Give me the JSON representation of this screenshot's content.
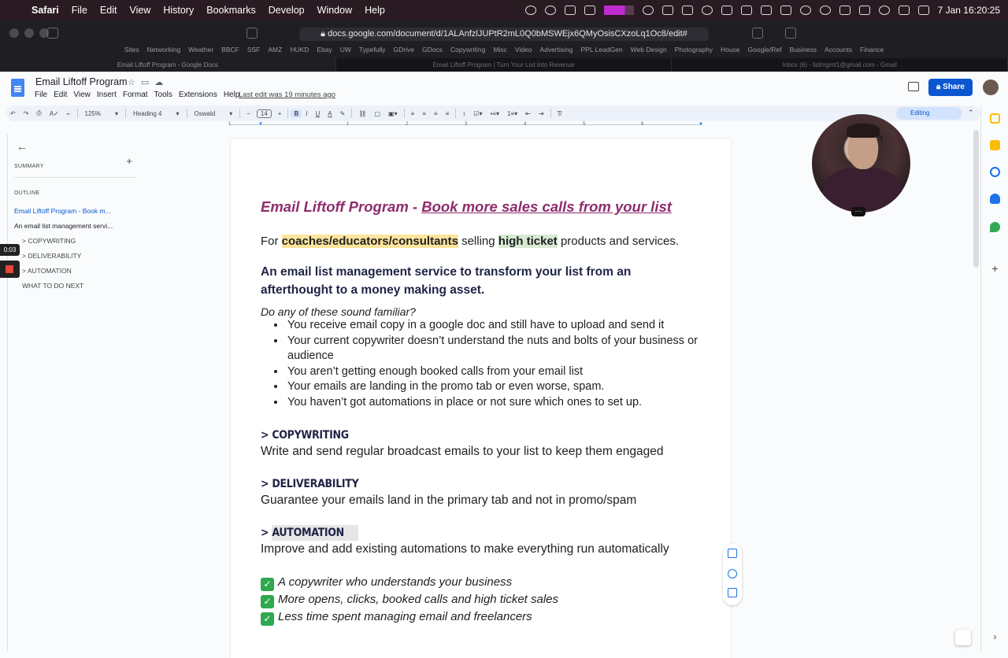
{
  "mac_menu": {
    "apple": "",
    "items": [
      "Safari",
      "File",
      "Edit",
      "View",
      "History",
      "Bookmarks",
      "Develop",
      "Window",
      "Help"
    ],
    "clock": "7 Jan  16:20:25"
  },
  "safari": {
    "url": "docs.google.com/document/d/1ALAnfzlJUPtR2mL0Q0bMSWEjx6QMyOsisCXzoLq1Oc8/edit#",
    "favorites": [
      "Sites",
      "Networking",
      "Weather",
      "BBCF",
      "SSF",
      "AMZ",
      "HUKD",
      "Ebay",
      "UW",
      "Typefully",
      "GDrive",
      "GDocs",
      "Copywriting",
      "Misc",
      "Video",
      "Advertising",
      "PPL LeadGen",
      "Web Design",
      "Photography",
      "House",
      "Google/Ref",
      "Business",
      "Accounts",
      "Finance"
    ],
    "tabs": [
      "Email Liftoff Program - Google Docs",
      "Email Liftoff Program | Turn Your List Into Revenue",
      "Inbox (6) - listmgmt1@gmail.com - Gmail"
    ]
  },
  "docs": {
    "title": "Email Liftoff Program",
    "menu": [
      "File",
      "Edit",
      "View",
      "Insert",
      "Format",
      "Tools",
      "Extensions",
      "Help"
    ],
    "last_edit": "Last edit was 19 minutes ago",
    "share": "Share",
    "toolbar": {
      "zoom": "125%",
      "style": "Heading 4",
      "font": "Oswald",
      "size": "14",
      "bold": "B",
      "italic": "I",
      "underline": "U",
      "text_color": "A",
      "mode": "Editing"
    },
    "ruler": [
      "1",
      "1",
      "2",
      "3",
      "4",
      "5",
      "6",
      "7"
    ]
  },
  "outline": {
    "summary": "SUMMARY",
    "outline_label": "OUTLINE",
    "items": [
      "Email Liftoff Program - Book m...",
      "An email list management servi...",
      "> COPYWRITING",
      "> DELIVERABILITY",
      "> AUTOMATION",
      "WHAT TO DO NEXT"
    ]
  },
  "recorder": {
    "time": "0:03"
  },
  "document": {
    "title_prefix": "Email Liftoff Program - ",
    "title_link": "Book more sales calls from your list",
    "intro_for": "For ",
    "intro_hl1": "coaches/educators/consultants",
    "intro_mid": " selling ",
    "intro_hl2": "high ticket",
    "intro_end": " products and services.",
    "subheading": "An email list management service to transform your list from an afterthought to a money making asset.",
    "question": "Do any of these sound familiar?",
    "bullets": [
      "You receive email copy in a google doc and still have to upload and send it",
      "Your current copywriter doesn’t understand the nuts and bolts of your business or audience",
      "You aren’t getting enough booked calls from your email list",
      "Your emails are landing in the promo tab or even worse, spam.",
      "You haven’t got automations in place or not sure which ones to set up."
    ],
    "sections": [
      {
        "heading": "> COPYWRITING",
        "text": "Write and send regular broadcast emails to your list to keep them engaged"
      },
      {
        "heading": "> DELIVERABILITY",
        "text": "Guarantee your emails land in the primary tab and not in promo/spam"
      },
      {
        "heading_prefix": "> ",
        "heading": "AUTOMATION",
        "text": "Improve and add existing automations to make everything run automatically"
      }
    ],
    "checks": [
      "A copywriter who understands your business",
      "More opens, clicks, booked calls and high ticket sales",
      "Less time spent managing email and freelancers"
    ],
    "check_mark": "✓"
  },
  "colors": {
    "title": "#8e2d6e",
    "heading": "#1f2346",
    "share": "#0b57d0",
    "highlight_yellow": "#fde49c",
    "highlight_green": "#d9ead3"
  }
}
